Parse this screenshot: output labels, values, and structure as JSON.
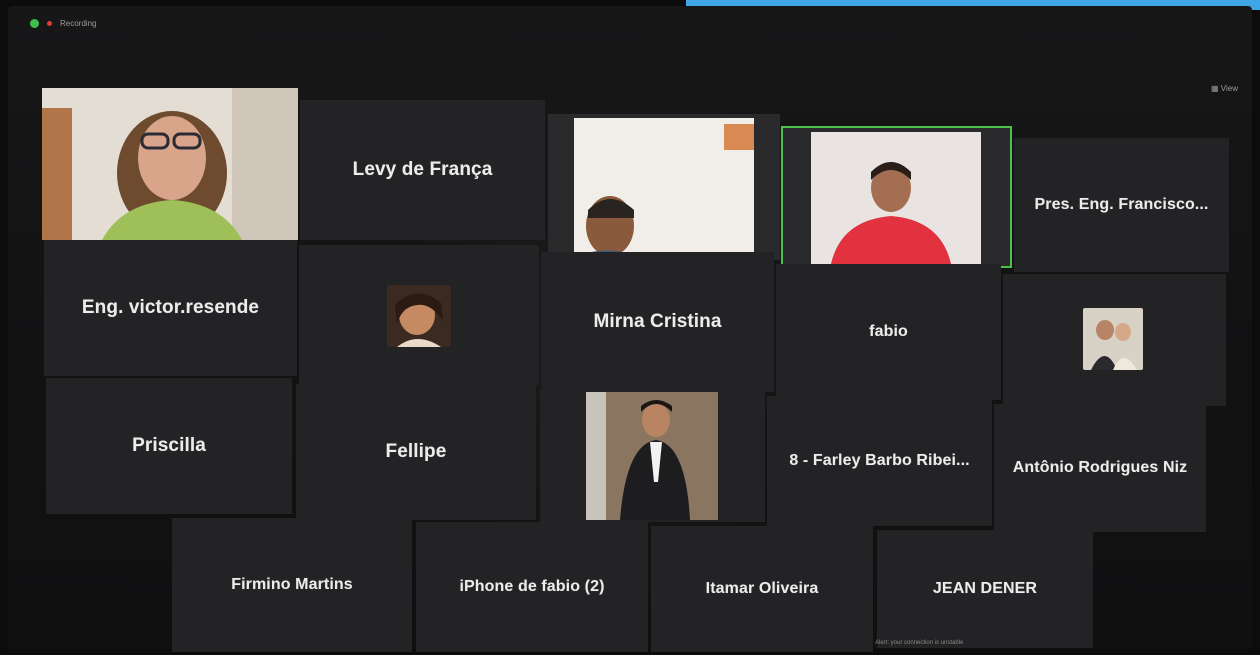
{
  "app": {
    "status_text": "Recording",
    "view_label": "View"
  },
  "footer": {
    "caption": "Alert: your connection is unstable"
  },
  "participants": [
    {
      "name": "",
      "type": "video"
    },
    {
      "name": "Levy de França",
      "type": "name"
    },
    {
      "name": "",
      "type": "video"
    },
    {
      "name": "",
      "type": "video",
      "active_speaker": true
    },
    {
      "name": "Pres. Eng. Francisco...",
      "type": "name"
    },
    {
      "name": "Eng. victor.resende",
      "type": "name"
    },
    {
      "name": "",
      "type": "avatar"
    },
    {
      "name": "Mirna Cristina",
      "type": "name"
    },
    {
      "name": "fabio",
      "type": "name"
    },
    {
      "name": "",
      "type": "avatar"
    },
    {
      "name": "Priscilla",
      "type": "name"
    },
    {
      "name": "Fellipe",
      "type": "name"
    },
    {
      "name": "",
      "type": "video"
    },
    {
      "name": "8 - Farley Barbo Ribei...",
      "type": "name"
    },
    {
      "name": "Antônio Rodrigues Niz",
      "type": "name"
    },
    {
      "name": "Firmino Martins",
      "type": "name"
    },
    {
      "name": "iPhone de fabio (2)",
      "type": "name"
    },
    {
      "name": "Itamar Oliveira",
      "type": "name"
    },
    {
      "name": "JEAN DENER",
      "type": "name"
    }
  ]
}
